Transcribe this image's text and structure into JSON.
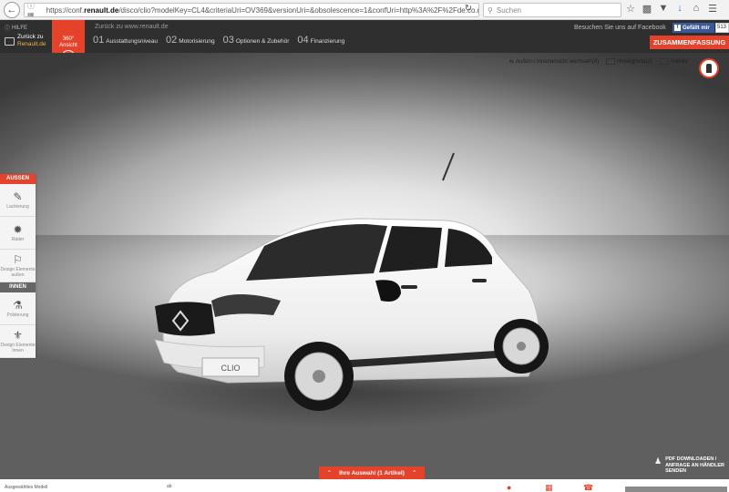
{
  "browser": {
    "url_prefix": "https://conf.",
    "url_domain": "renault.de",
    "url_rest": "/disco/clio?modelKey=CL4&criteriaUri=OV369&versionUri=&obsolescence=1&confUri=http%3A%2F%2Fde.co.r",
    "search_placeholder": "Suchen"
  },
  "header": {
    "help_label": "HILFE",
    "back_line1": "Zurück zu",
    "back_line2": "Renault.de",
    "badge_360_line1": "360°",
    "badge_360_line2": "Ansicht",
    "back_link": "Zurück zu www.renault.de",
    "steps": [
      {
        "num": "01",
        "label": "Ausstattungsniveau"
      },
      {
        "num": "02",
        "label": "Motorisierung"
      },
      {
        "num": "03",
        "label": "Optionen & Zubehör"
      },
      {
        "num": "04",
        "label": "Finanzierung"
      }
    ],
    "facebook_text": "Besuchen Sie uns auf Facebook",
    "like_label": "Gefällt mir",
    "like_count": "513",
    "summary_label": "ZUSAMMENFASSUNG"
  },
  "view_tools": {
    "toggle_view": "Außen-/ Innenansicht wechseln(4)",
    "background": "Hintergrund(2)",
    "fullscreen": "Vollbild"
  },
  "car": {
    "plate": "CLIO",
    "body_color": "#f7f7f7"
  },
  "sidebar": {
    "exterior_title": "AUSSEN",
    "exterior_items": [
      {
        "label": "Lackierung",
        "icon": "paint-gun-icon"
      },
      {
        "label": "Räder",
        "icon": "wheel-icon"
      },
      {
        "label": "Design Elemente außen",
        "icon": "car-design-icon"
      }
    ],
    "interior_title": "INNEN",
    "interior_items": [
      {
        "label": "Polsterung",
        "icon": "seat-icon"
      },
      {
        "label": "Design Elemente Innen",
        "icon": "steering-icon"
      }
    ]
  },
  "selection": {
    "label": "Ihre Auswahl (1 Artikel)"
  },
  "pdf": {
    "line1": "PDF DOWNLOADEN /",
    "line2": "ANFRAGE AN HÄNDLER",
    "line3": "SENDEN"
  },
  "footer": {
    "model_label": "Ausgewähltes Modell",
    "price_label": "ab"
  },
  "colors": {
    "accent": "#e4422b",
    "header_bg": "#2f2f2f",
    "link_orange": "#f0b437"
  }
}
